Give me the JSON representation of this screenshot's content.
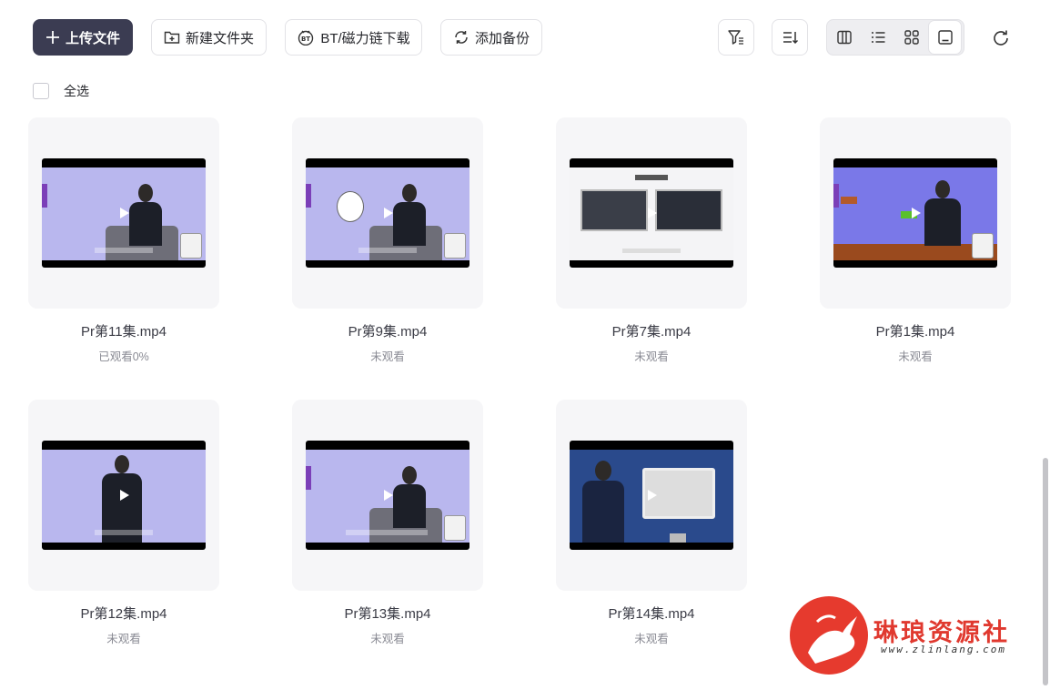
{
  "toolbar": {
    "upload_label": "上传文件",
    "new_folder_label": "新建文件夹",
    "bt_label": "BT/磁力链下载",
    "backup_label": "添加备份"
  },
  "select_all_label": "全选",
  "files": [
    {
      "name": "Pr第11集.mp4",
      "status": "已观看0%",
      "scene": "purple-sit"
    },
    {
      "name": "Pr第9集.mp4",
      "status": "未观看",
      "scene": "purple-meme"
    },
    {
      "name": "Pr第7集.mp4",
      "status": "未观看",
      "scene": "white-slide"
    },
    {
      "name": "Pr第1集.mp4",
      "status": "未观看",
      "scene": "purple-game"
    },
    {
      "name": "Pr第12集.mp4",
      "status": "未观看",
      "scene": "purple-stand"
    },
    {
      "name": "Pr第13集.mp4",
      "status": "未观看",
      "scene": "purple-sit"
    },
    {
      "name": "Pr第14集.mp4",
      "status": "未观看",
      "scene": "blue-studio"
    }
  ],
  "watermark": {
    "title": "琳琅资源社",
    "url": "www.zlinlang.com"
  },
  "colors": {
    "primary_button": "#3b3c52",
    "thumb_bg": "#f6f6f8",
    "video_purple": "#b7b5ee",
    "watermark_red": "#e63a2e"
  }
}
